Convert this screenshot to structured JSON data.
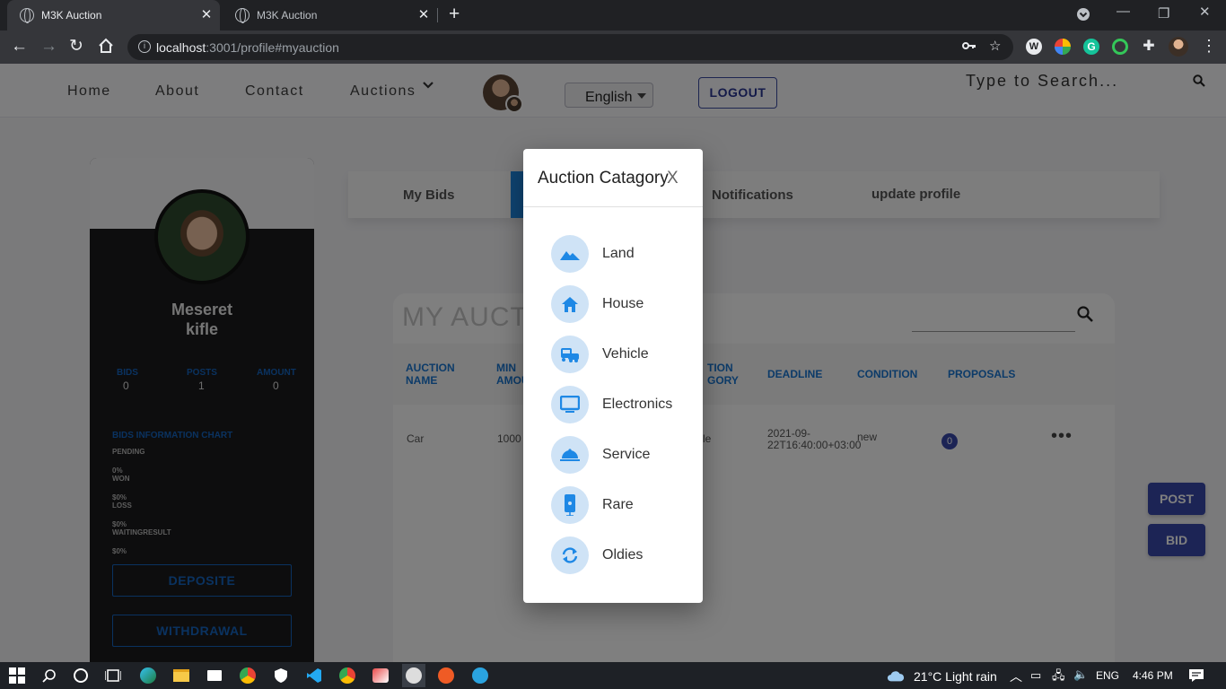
{
  "browser": {
    "tabs": [
      {
        "title": "M3K Auction",
        "active": true
      },
      {
        "title": "M3K Auction",
        "active": false
      }
    ],
    "address": {
      "host": "localhost",
      "rest": ":3001/profile#myauction"
    }
  },
  "site": {
    "nav": [
      "Home",
      "About",
      "Contact",
      "Auctions"
    ],
    "language": "English",
    "logout_label": "LOGOUT",
    "search_placeholder": "Type to Search..."
  },
  "profile": {
    "name_first": "Meseret",
    "name_last": "kifle",
    "stats": [
      {
        "label": "BIDS",
        "value": "0"
      },
      {
        "label": "POSTS",
        "value": "1"
      },
      {
        "label": "AMOUNT",
        "value": "0"
      }
    ],
    "chart_title": "BIDS INFORMATION CHART",
    "chart_rows": [
      {
        "label": "PENDING",
        "value": "0%"
      },
      {
        "label": "WON",
        "value": "$0%"
      },
      {
        "label": "LOSS",
        "value": "$0%"
      },
      {
        "label": "WAITINGRESULT",
        "value": "$0%"
      }
    ],
    "deposit_label": "DEPOSITE",
    "withdrawal_label": "WITHDRAWAL"
  },
  "profile_tabs": [
    "My Bids",
    "Notifications",
    "update profile"
  ],
  "auctions": {
    "title": "MY AUCTI",
    "columns": [
      "AUCTION NAME",
      "MIN AMOUNT",
      "AUCTION CATEGORY",
      "DEADLINE",
      "CONDITION",
      "PROPOSALS"
    ],
    "column_parts": {
      "name": [
        "AUCTION",
        "NAME"
      ],
      "min": [
        "MIN",
        "AMOU"
      ],
      "cat": [
        "TION",
        "GORY"
      ]
    },
    "row": {
      "name": "Car",
      "min_amount": "1000",
      "category_tail": "le",
      "deadline_1": "2021-09-",
      "deadline_2": "22T16:40:00+03:00",
      "condition": "new",
      "proposals": "0"
    }
  },
  "side_buttons": {
    "post": "POST",
    "bid": "BID"
  },
  "modal": {
    "title": "Auction Catagory",
    "close": "X",
    "categories": [
      {
        "label": "Land",
        "icon": "landscape-icon"
      },
      {
        "label": "House",
        "icon": "house-icon"
      },
      {
        "label": "Vehicle",
        "icon": "vehicle-icon"
      },
      {
        "label": "Electronics",
        "icon": "monitor-icon"
      },
      {
        "label": "Service",
        "icon": "service-bell-icon"
      },
      {
        "label": "Rare",
        "icon": "phone-icon"
      },
      {
        "label": "Oldies",
        "icon": "refresh-icon"
      }
    ]
  },
  "taskbar": {
    "weather": "21°C  Light rain",
    "lang": "ENG",
    "time": "4:46 PM"
  },
  "colors": {
    "accent": "#1976d2",
    "primary": "#3949ab",
    "category_bg": "#cfe3f6"
  }
}
